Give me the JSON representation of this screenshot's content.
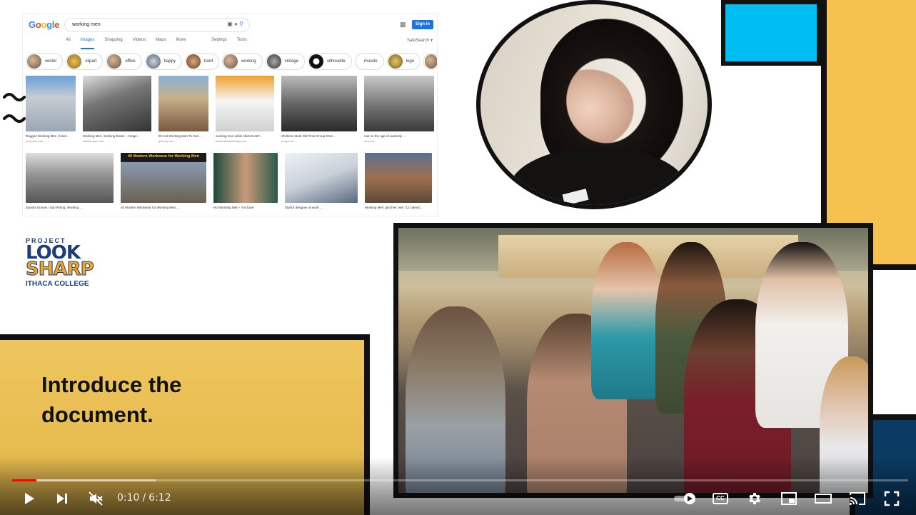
{
  "google": {
    "logo": "Google",
    "search_query": "working men",
    "sign_in": "Sign in",
    "tabs": [
      "All",
      "Images",
      "Shopping",
      "Videos",
      "Maps",
      "More"
    ],
    "active_tab": "Images",
    "tools": [
      "Settings",
      "Tools"
    ],
    "safesearch": "SafeSearch ▾",
    "chips": [
      "vector",
      "clipart",
      "office",
      "happy",
      "hard",
      "working",
      "vintage",
      "silhouette",
      "muscle",
      "logo"
    ],
    "row1": [
      {
        "caption": "Rugged Working Men | Hard...",
        "source": "pinterest.com"
      },
      {
        "caption": "Working Men, Working Boats ~ Image...",
        "source": "millionmoore.net"
      },
      {
        "caption": "50 Hot Working Men To Get...",
        "source": "queerty.com"
      },
      {
        "caption": "working men white shirts21467...",
        "source": "kelsheaithanksbaby.com"
      },
      {
        "caption": "Shirtless Male Old Time Group Shot ...",
        "source": "ebay.com"
      },
      {
        "caption": "man in the age of austerity ...",
        "source": "aeon.co"
      }
    ],
    "row2": [
      {
        "caption": "Sandra Graves / Iato Rising: Working ...",
        "source": ""
      },
      {
        "caption": "40 Modern Workwear for Working Men ...",
        "source": ""
      },
      {
        "caption": "Hot Working Men - YouTube",
        "source": ""
      },
      {
        "caption": "Stylish designer at work ...",
        "source": ""
      },
      {
        "caption": "Working Men' get their own \"12 calend...",
        "source": ""
      }
    ],
    "banner_text": "40 Modern Workwear for Working Men"
  },
  "logo": {
    "project": "PROJECT",
    "look": "LOOK",
    "sharp": "SHARP",
    "college": "ITHACA COLLEGE"
  },
  "heading": {
    "line1": "Introduce the",
    "line2": "document."
  },
  "player": {
    "current_time": "0:10",
    "separator": "/",
    "duration": "6:12",
    "progress_fraction": 0.027,
    "buffer_fraction": 0.16,
    "muted": true,
    "cc_label": "CC"
  },
  "colors": {
    "cyan": "#00bdf2",
    "yellow": "#f5c14f",
    "navy": "#0b3a63",
    "progress_red": "#ff0000"
  }
}
